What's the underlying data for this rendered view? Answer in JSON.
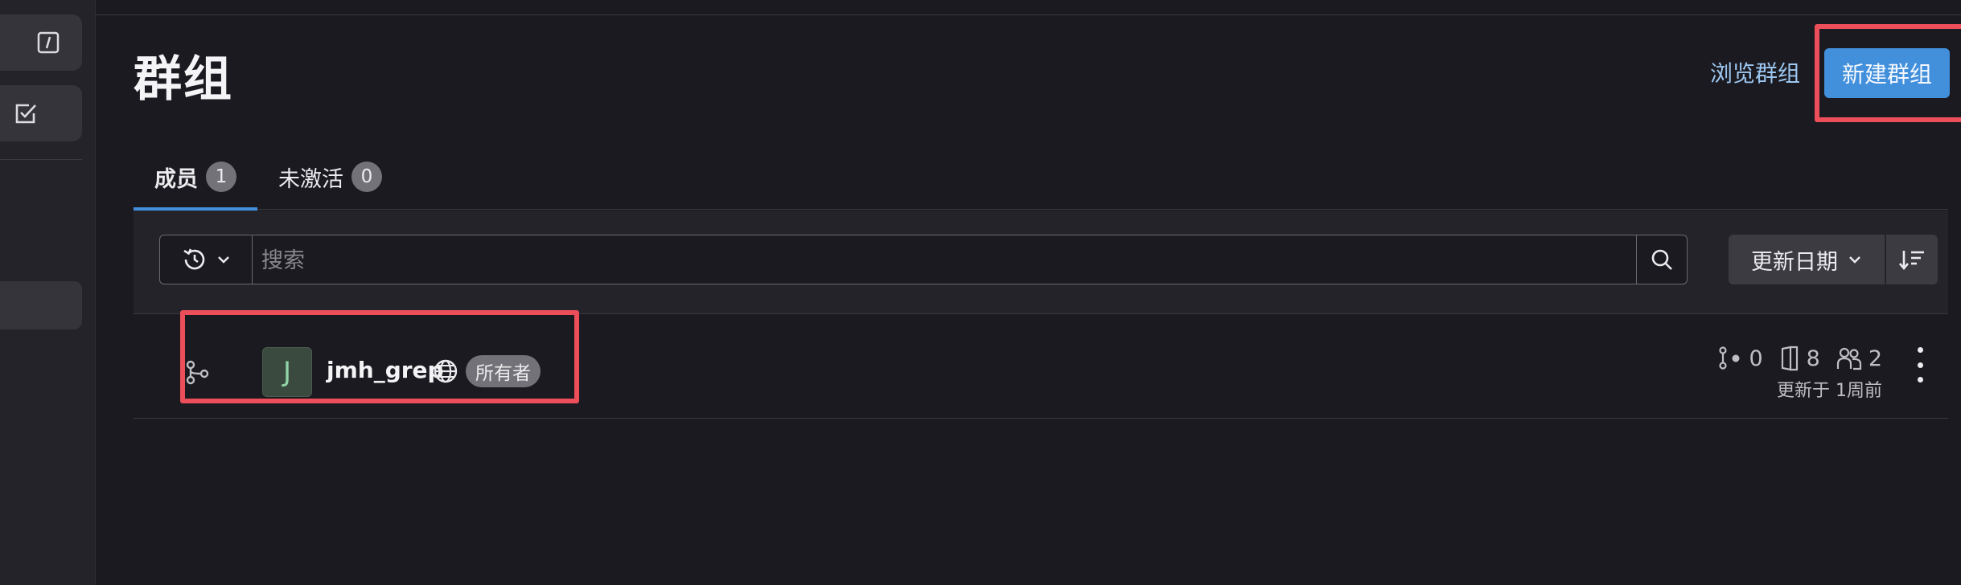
{
  "page": {
    "title": "群组",
    "browse_label": "浏览群组",
    "new_group_label": "新建群组"
  },
  "tabs": [
    {
      "label": "成员",
      "count": "1",
      "active": true
    },
    {
      "label": "未激活",
      "count": "0",
      "active": false
    }
  ],
  "search": {
    "placeholder": "搜索",
    "value": ""
  },
  "sort": {
    "label": "更新日期"
  },
  "groups": [
    {
      "avatar_letter": "J",
      "name": "jmh_grep",
      "visibility_icon": "globe-icon",
      "role": "所有者",
      "subgroups": "0",
      "projects": "8",
      "members": "2",
      "updated": "更新于 1周前"
    }
  ],
  "colors": {
    "accent": "#428fdc",
    "highlight": "#ed4f5a",
    "background": "#1b1a20"
  }
}
